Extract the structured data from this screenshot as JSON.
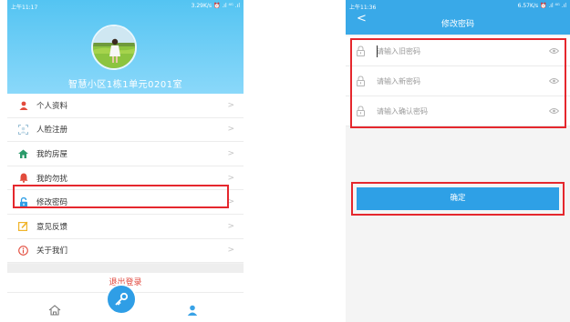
{
  "left_screen": {
    "status_bar": {
      "time": "上午11:17",
      "right": "3.29K/s ⏰ .ıl ⁴ᴳ .ıl"
    },
    "address": "智慧小区1栋1单元0201室",
    "menu": [
      {
        "label": "个人资料",
        "icon": "person-icon",
        "color": "#e24b3c"
      },
      {
        "label": "人脸注册",
        "icon": "face-scan-icon",
        "color": "#9bc0d6"
      },
      {
        "label": "我的房屋",
        "icon": "house-icon",
        "color": "#2a9a6a"
      },
      {
        "label": "我的勿扰",
        "icon": "bell-icon",
        "color": "#e24b3c"
      },
      {
        "label": "修改密码",
        "icon": "lock-icon",
        "color": "#2f9ee6"
      },
      {
        "label": "意见反馈",
        "icon": "edit-icon",
        "color": "#f0b429"
      },
      {
        "label": "关于我们",
        "icon": "info-icon",
        "color": "#e24b3c"
      }
    ],
    "chevron": ">",
    "logout": "退出登录",
    "tabs": {
      "home": "首页",
      "me": "我"
    }
  },
  "right_screen": {
    "status_bar": {
      "time": "上午11:36",
      "right": "6.57K/s ⏰ .ıl ⁴ᴳ .ıl"
    },
    "back": "<",
    "title": "修改密码",
    "fields": [
      {
        "placeholder": "请输入旧密码",
        "value": ""
      },
      {
        "placeholder": "请输入新密码",
        "value": ""
      },
      {
        "placeholder": "请输入确认密码",
        "value": ""
      }
    ],
    "confirm_label": "确定"
  },
  "colors": {
    "accent": "#39a9e8",
    "highlight": "#e5272d",
    "logout": "#e0473d"
  }
}
